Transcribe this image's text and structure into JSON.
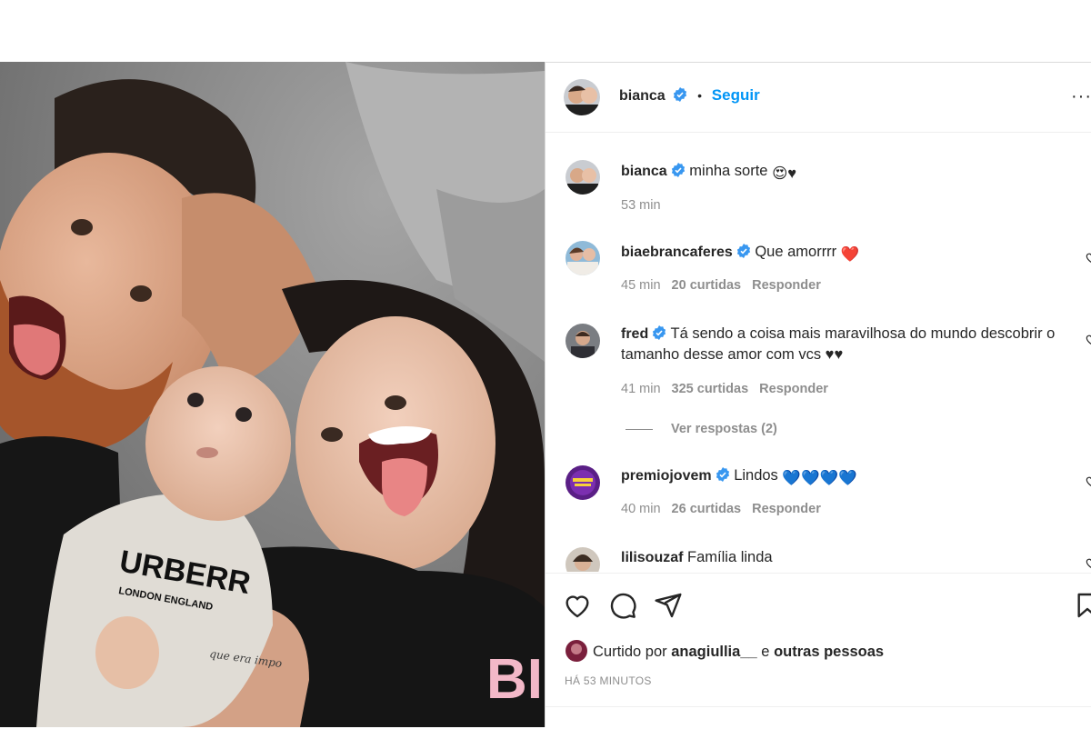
{
  "post": {
    "author": "bianca",
    "follow_label": "Seguir",
    "dot": "•",
    "more": "···"
  },
  "photo": {
    "shirt_text_1": "URBERR",
    "shirt_text_2": "LONDON ENGLAND",
    "shirt_text_3": "BI",
    "tattoo_text": "que era impo"
  },
  "caption": {
    "username": "bianca",
    "text": "minha sorte",
    "emoji": "😍♥",
    "time": "53 min"
  },
  "comments": [
    {
      "username": "biaebrancaferes",
      "text": "Que amorrrr",
      "emoji": "❤️",
      "time": "45 min",
      "likes": "20 curtidas",
      "reply": "Responder"
    },
    {
      "username": "fred",
      "text": "Tá sendo a coisa mais maravilhosa do mundo descobrir o tamanho desse amor com vcs ♥♥",
      "time": "41 min",
      "likes": "325 curtidas",
      "reply": "Responder",
      "view_replies": "Ver respostas (2)"
    },
    {
      "username": "premiojovem",
      "text": "Lindos",
      "emoji": "💙💙💙💙",
      "time": "40 min",
      "likes": "26 curtidas",
      "reply": "Responder"
    },
    {
      "username": "lilisouzaf",
      "text": "Família linda"
    }
  ],
  "footer": {
    "liked_prefix": "Curtido por",
    "liked_user": "anagiullia__",
    "liked_and": "e",
    "liked_rest": "outras pessoas",
    "timestamp": "HÁ 53 MINUTOS"
  },
  "colors": {
    "accent": "#0095f6",
    "text": "#262626",
    "muted": "#8e8e8e",
    "verified": "#3897f0"
  },
  "icons": [
    "verified-badge-icon",
    "like-heart-icon",
    "comment-icon",
    "share-icon",
    "save-bookmark-icon",
    "more-options-icon"
  ]
}
